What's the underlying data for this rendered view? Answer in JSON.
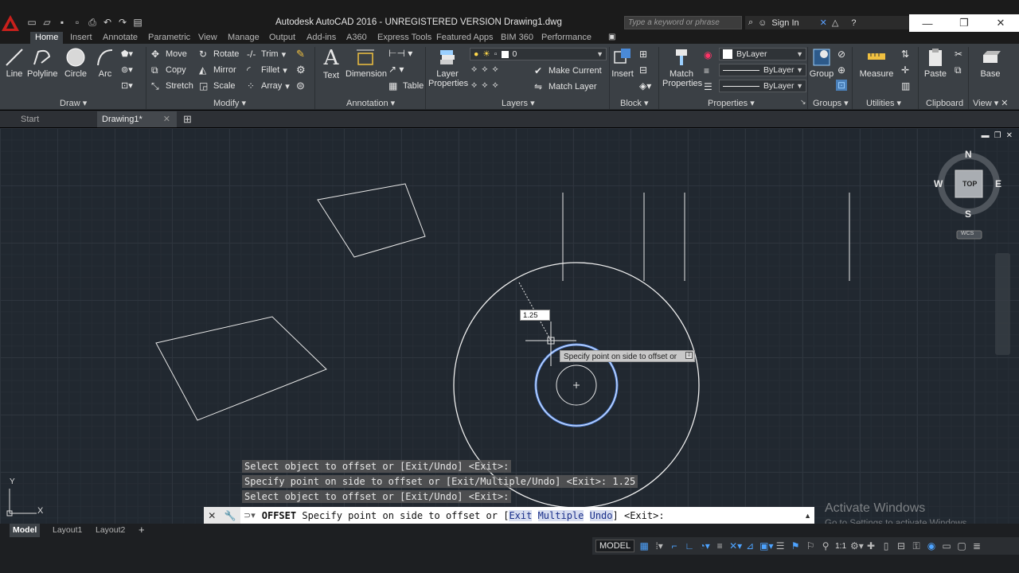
{
  "window": {
    "title": "Autodesk AutoCAD 2016 - UNREGISTERED VERSION    Drawing1.dwg",
    "search_placeholder": "Type a keyword or phrase",
    "signin_label": "Sign In"
  },
  "ribbon_tabs": [
    "Home",
    "Insert",
    "Annotate",
    "Parametric",
    "View",
    "Manage",
    "Output",
    "Add-ins",
    "A360",
    "Express Tools",
    "Featured Apps",
    "BIM 360",
    "Performance"
  ],
  "draw_panel": {
    "title": "Draw",
    "line": "Line",
    "polyline": "Polyline",
    "circle": "Circle",
    "arc": "Arc"
  },
  "modify_panel": {
    "title": "Modify",
    "move": "Move",
    "rotate": "Rotate",
    "trim": "Trim",
    "copy": "Copy",
    "mirror": "Mirror",
    "fillet": "Fillet",
    "stretch": "Stretch",
    "scale": "Scale",
    "array": "Array"
  },
  "annotation_panel": {
    "title": "Annotation",
    "text": "Text",
    "dimension": "Dimension",
    "table": "Table"
  },
  "layers_panel": {
    "title": "Layers",
    "layer_properties_1": "Layer",
    "layer_properties_2": "Properties",
    "current_layer": "0",
    "make_current": "Make Current",
    "match_layer": "Match Layer"
  },
  "block_panel": {
    "title": "Block",
    "insert": "Insert"
  },
  "properties_panel": {
    "title": "Properties",
    "match_1": "Match",
    "match_2": "Properties",
    "color": "ByLayer",
    "linetype": "ByLayer",
    "lineweight": "ByLayer"
  },
  "groups_panel": {
    "title": "Groups",
    "group": "Group"
  },
  "utilities_panel": {
    "title": "Utilities",
    "measure": "Measure"
  },
  "clipboard_panel": {
    "title": "Clipboard",
    "paste": "Paste"
  },
  "view_panel": {
    "title": "View",
    "base": "Base"
  },
  "file_tabs": {
    "start": "Start",
    "drawing": "Drawing1*"
  },
  "viewcube": {
    "n": "N",
    "s": "S",
    "e": "E",
    "w": "W",
    "face": "TOP",
    "wcs": "WCS"
  },
  "ucs": {
    "y": "Y",
    "x": "X"
  },
  "dynamic_input_value": "1.25",
  "tooltip": "Specify point on side to offset or",
  "command_history": [
    "Select object to offset or [Exit/Undo] <Exit>:",
    "Specify point on side to offset or [Exit/Multiple/Undo] <Exit>: 1.25",
    "Select object to offset or [Exit/Undo] <Exit>:"
  ],
  "command_line": {
    "command": "OFFSET",
    "prompt": "Specify point on side to offset or [",
    "opt_exit": "Exit",
    "opt_multiple": "Multiple",
    "opt_undo": "Undo",
    "suffix": "] <Exit>:"
  },
  "layout_tabs": [
    "Model",
    "Layout1",
    "Layout2"
  ],
  "status": {
    "model": "MODEL",
    "scale": "1:1"
  },
  "watermark": {
    "line1": "Activate Windows",
    "line2": "Go to Settings to activate Windows."
  }
}
